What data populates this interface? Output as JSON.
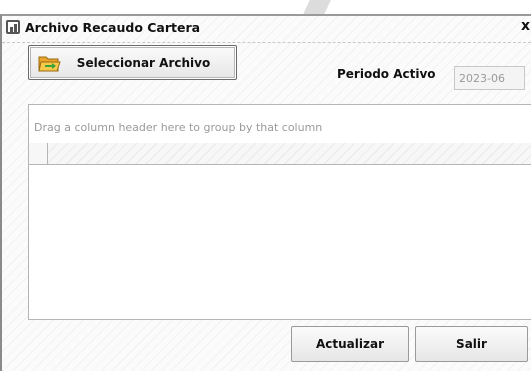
{
  "window": {
    "title": "Archivo Recaudo Cartera",
    "close_label": "x"
  },
  "toolbar": {
    "select_file_label": "Seleccionar Archivo",
    "select_file_icon": "folder-icon"
  },
  "period": {
    "label": "Periodo Activo",
    "value": "2023-06"
  },
  "grid": {
    "group_panel_text": "Drag a column header here to group by that column",
    "columns": [],
    "rows": []
  },
  "footer": {
    "update_label": "Actualizar",
    "exit_label": "Salir"
  }
}
